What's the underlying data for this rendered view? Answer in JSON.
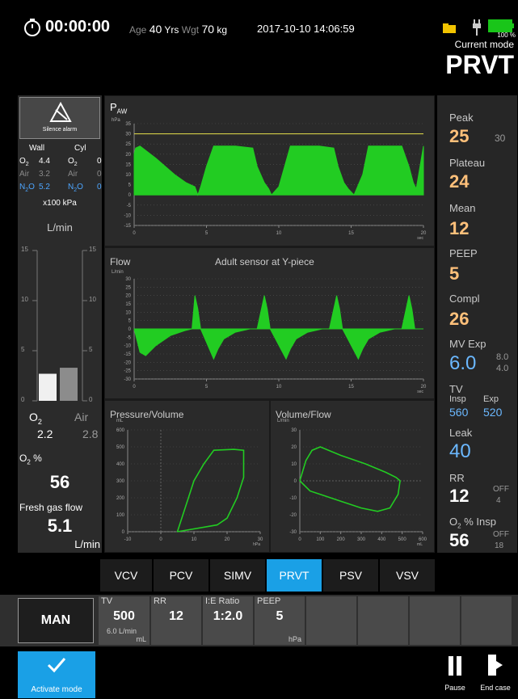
{
  "header": {
    "timer": "00:00:00",
    "age_label": "Age",
    "age_value": "40",
    "age_unit": "Yrs",
    "weight_label": "Wgt",
    "weight_value": "70",
    "weight_unit": "kg",
    "datetime": "2017-10-10  14:06:59",
    "battery_percent": "100 %",
    "current_mode_label": "Current mode",
    "current_mode": "PRVT"
  },
  "left": {
    "silence_alarm_label": "Silence alarm",
    "wall_label": "Wall",
    "cyl_label": "Cyl",
    "rows": [
      {
        "gas": "O2",
        "wall": "4.4",
        "cyl_gas": "O2",
        "cyl": "0"
      },
      {
        "gas": "Air",
        "wall": "3.2",
        "cyl_gas": "Air",
        "cyl": "0"
      },
      {
        "gas": "N2O",
        "wall": "5.2",
        "cyl_gas": "N2O",
        "cyl": "0"
      }
    ],
    "pressure_unit": "x100 kPa",
    "flow_unit": "L/min",
    "scale_ticks": [
      "15",
      "10",
      "5",
      "0"
    ],
    "o2_flow_label": "O2",
    "o2_flow": "2.2",
    "air_flow_label": "Air",
    "air_flow": "2.8",
    "o2_percent_label": "O2 %",
    "o2_percent": "56",
    "fresh_gas_label": "Fresh gas flow",
    "fresh_gas_value": "5.1",
    "fresh_gas_unit": "L/min",
    "o2_bar_level": 0.18,
    "air_bar_level": 0.22
  },
  "waveforms": {
    "paw_title": "P",
    "paw_sub": "AW",
    "paw_unit": "hPa",
    "flow_title": "Flow",
    "flow_unit": "L/min",
    "flow_note": "Adult sensor at Y-piece",
    "x_unit": "sec",
    "pv_title": "Pressure/Volume",
    "vf_title": "Volume/Flow",
    "pv_unit_y": "mL",
    "pv_unit_x": "hPa",
    "vf_unit_y": "L/min",
    "vf_unit_x": "mL"
  },
  "chart_data": [
    {
      "type": "area",
      "title": "PAW",
      "ylabel": "hPa",
      "xlabel": "sec",
      "x_ticks": [
        "0",
        "5",
        "10",
        "15",
        "20"
      ],
      "y_ticks": [
        "35",
        "30",
        "25",
        "20",
        "15",
        "10",
        "5",
        "0",
        "-5",
        "-10",
        "-15"
      ],
      "xlim": [
        0,
        20
      ],
      "ylim": [
        -15,
        35
      ],
      "limit_line": 30,
      "series": [
        {
          "x": [
            0,
            0.1,
            0.4,
            1.5,
            2.8,
            3.6,
            4.2,
            4.4,
            4.6,
            5.0,
            5.5,
            7.0,
            8.2,
            8.5,
            9.0,
            9.3,
            9.5,
            10.0,
            10.8,
            12.8,
            13.8,
            14.1,
            14.5,
            14.8,
            15.2,
            15.8,
            16.2,
            17.2,
            18.5,
            19.0,
            19.3,
            19.5,
            20.0
          ],
          "y": [
            20,
            23,
            24,
            18,
            10,
            6,
            4,
            0,
            4,
            14,
            24,
            24,
            23,
            14,
            6,
            3,
            0,
            4,
            24,
            24,
            23,
            14,
            6,
            3,
            0,
            10,
            24,
            24,
            24,
            14,
            6,
            3,
            24
          ]
        }
      ]
    },
    {
      "type": "area",
      "title": "Flow",
      "ylabel": "L/min",
      "xlabel": "sec",
      "x_ticks": [
        "0",
        "5",
        "10",
        "15",
        "20"
      ],
      "y_ticks": [
        "30",
        "25",
        "20",
        "15",
        "10",
        "5",
        "0",
        "-5",
        "-10",
        "-15",
        "-20",
        "-25",
        "-30"
      ],
      "xlim": [
        0,
        20
      ],
      "ylim": [
        -30,
        30
      ],
      "series": [
        {
          "x": [
            0,
            0.4,
            0.8,
            1.5,
            2.5,
            3.5,
            4.0,
            4.2,
            4.4,
            4.6,
            5.5,
            5.8,
            6.2,
            7.0,
            8.0,
            8.5,
            9.0,
            9.2,
            9.4,
            10.5,
            10.8,
            11.2,
            12.0,
            13.0,
            13.5,
            14.0,
            14.2,
            14.4,
            15.5,
            15.8,
            16.2,
            17.0,
            18.0,
            18.5,
            19.0,
            19.2,
            19.4,
            20.0
          ],
          "y": [
            0,
            -14,
            -16,
            -10,
            -4,
            -1,
            0,
            20,
            12,
            0,
            -18,
            -12,
            -6,
            -2,
            0,
            0,
            20,
            12,
            0,
            -18,
            -12,
            -6,
            -2,
            0,
            0,
            20,
            12,
            0,
            -18,
            -12,
            -6,
            -2,
            0,
            0,
            20,
            12,
            0,
            0
          ]
        }
      ]
    },
    {
      "type": "line",
      "title": "Pressure/Volume",
      "ylabel": "mL",
      "xlabel": "hPa",
      "x_ticks": [
        "-10",
        "0",
        "10",
        "20",
        "30"
      ],
      "y_ticks": [
        "600",
        "500",
        "400",
        "300",
        "200",
        "100",
        "0"
      ],
      "xlim": [
        -10,
        30
      ],
      "ylim": [
        0,
        600
      ],
      "series": [
        {
          "x": [
            5,
            14,
            17,
            20,
            23,
            25,
            25,
            22,
            16,
            13,
            10,
            8,
            5
          ],
          "y": [
            0,
            30,
            40,
            80,
            200,
            320,
            480,
            485,
            480,
            400,
            300,
            180,
            0
          ]
        }
      ]
    },
    {
      "type": "line",
      "title": "Volume/Flow",
      "ylabel": "L/min",
      "xlabel": "mL",
      "x_ticks": [
        "0",
        "100",
        "200",
        "300",
        "400",
        "500",
        "600"
      ],
      "y_ticks": [
        "30",
        "20",
        "10",
        "0",
        "-10",
        "-20",
        "-30"
      ],
      "xlim": [
        0,
        600
      ],
      "ylim": [
        -30,
        30
      ],
      "series": [
        {
          "x": [
            0,
            30,
            60,
            100,
            200,
            320,
            420,
            470,
            490,
            480,
            440,
            380,
            300,
            200,
            100,
            50,
            0
          ],
          "y": [
            0,
            12,
            18,
            20,
            15,
            10,
            5,
            2,
            0,
            -8,
            -16,
            -18,
            -16,
            -12,
            -8,
            -6,
            0
          ]
        }
      ]
    }
  ],
  "right": {
    "peak_label": "Peak",
    "peak_value": "25",
    "peak_limit": "30",
    "plateau_label": "Plateau",
    "plateau_value": "24",
    "mean_label": "Mean",
    "mean_value": "12",
    "peep_label": "PEEP",
    "peep_value": "5",
    "compl_label": "Compl",
    "compl_value": "26",
    "mv_label": "MV Exp",
    "mv_value": "6.0",
    "mv_high": "8.0",
    "mv_low": "4.0",
    "tv_label": "TV",
    "tv_insp_label": "Insp",
    "tv_exp_label": "Exp",
    "tv_insp": "560",
    "tv_exp": "520",
    "leak_label": "Leak",
    "leak_value": "40",
    "rr_label": "RR",
    "rr_value": "12",
    "rr_high": "OFF",
    "rr_low": "4",
    "o2insp_label": "O2 % Insp",
    "o2insp_value": "56",
    "o2insp_high": "OFF",
    "o2insp_low": "18"
  },
  "modes": [
    "VCV",
    "PCV",
    "SIMV",
    "PRVT",
    "PSV",
    "VSV"
  ],
  "active_mode": "PRVT",
  "settings": {
    "man_label": "MAN",
    "tv_label": "TV",
    "tv_value": "500",
    "tv_sub": "6.0 L/min",
    "tv_unit": "mL",
    "rr_label": "RR",
    "rr_value": "12",
    "ie_label": "I:E Ratio",
    "ie_value": "1:2.0",
    "peep_label": "PEEP",
    "peep_value": "5",
    "peep_unit": "hPa"
  },
  "footer": {
    "activate_label": "Activate mode",
    "pause_label": "Pause",
    "end_case_label": "End case"
  },
  "colors": {
    "accent": "#1aa0e6",
    "wave": "#22cc22",
    "value_orange": "#ffc07a",
    "value_blue": "#6bb8ff",
    "n2o_blue": "#4da6ff",
    "limit_yellow": "#e6e04a"
  }
}
